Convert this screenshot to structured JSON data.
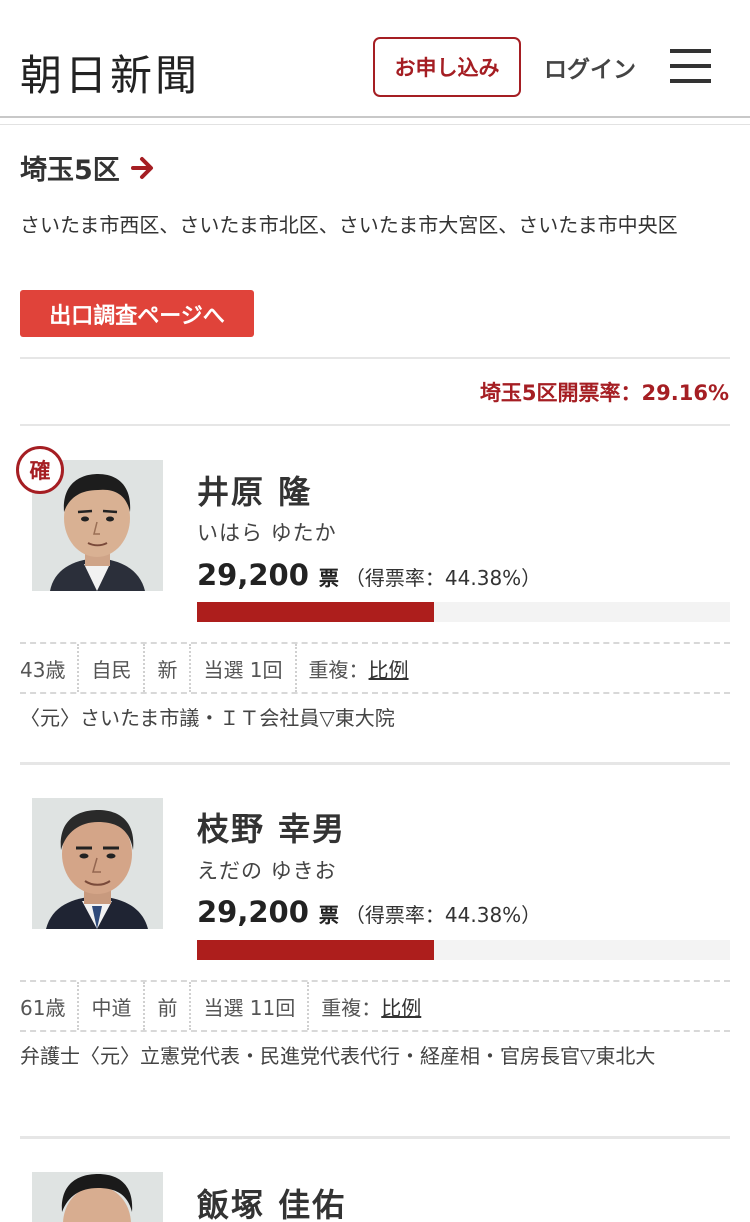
{
  "header": {
    "logo": "朝日新聞",
    "apply_label": "お申し込み",
    "login_label": "ログイン",
    "menu_icon": "hamburger-menu-icon"
  },
  "district": {
    "name": "埼玉5区",
    "arrow_icon": "arrow-right-icon",
    "area": "さいたま市西区、さいたま市北区、さいたま市大宮区、さいたま市中央区",
    "exit_poll_label": "出口調査ページへ",
    "counting_rate": "埼玉5区開票率：29.16%"
  },
  "colors": {
    "brand": "#a51e23",
    "exit_button": "#e0433a",
    "vote_bar": "#ad1e1c"
  },
  "candidates": [
    {
      "elected_badge": "確",
      "name": "井原 隆",
      "kana": "いはら ゆたか",
      "votes": "29,200",
      "vote_unit": "票",
      "vote_share_text": "（得票率：44.38%）",
      "vote_share": 44.38,
      "age": "43歳",
      "party": "自民",
      "status": "新",
      "terms": "当選 1回",
      "dual_label": "重複：",
      "dual_link": "比例",
      "career": "〈元〉さいたま市議・ＩＴ会社員▽東大院"
    },
    {
      "name": "枝野 幸男",
      "kana": "えだの ゆきお",
      "votes": "29,200",
      "vote_unit": "票",
      "vote_share_text": "（得票率：44.38%）",
      "vote_share": 44.38,
      "age": "61歳",
      "party": "中道",
      "status": "前",
      "terms": "当選 11回",
      "dual_label": "重複：",
      "dual_link": "比例",
      "career": "弁護士〈元〉立憲党代表・民進党代表代行・経産相・官房長官▽東北大"
    },
    {
      "name": "飯塚 佳佑"
    }
  ]
}
